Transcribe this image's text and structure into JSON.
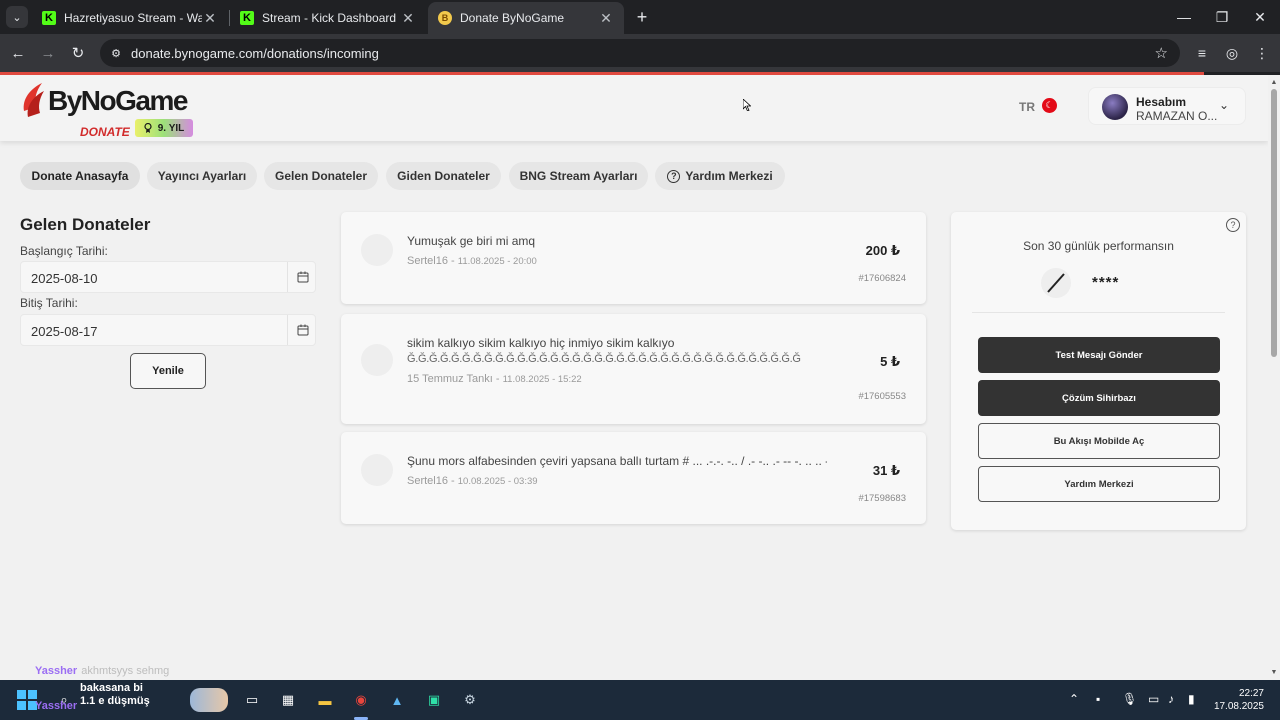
{
  "browser": {
    "tabs": [
      {
        "title": "Hazretiyasuo Stream - Watch Li",
        "favicon": "kick-icon"
      },
      {
        "title": "Stream - Kick Dashboard",
        "favicon": "kick-icon"
      },
      {
        "title": "Donate ByNoGame",
        "favicon": "bynogame-icon",
        "active": true
      }
    ],
    "url": "donate.bynogame.com/donations/incoming"
  },
  "header": {
    "logo_word": "ByNoGame",
    "logo_sub": "DONATE",
    "badge": "9. YIL",
    "lang": "TR",
    "account_title": "Hesabım",
    "account_name": "RAMAZAN O..."
  },
  "nav": [
    "Donate Anasayfa",
    "Yayıncı Ayarları",
    "Gelen Donateler",
    "Giden Donateler",
    "BNG Stream Ayarları",
    "Yardım Merkezi"
  ],
  "filters": {
    "title": "Gelen Donateler",
    "start_label": "Başlangıç Tarihi:",
    "start_value": "2025-08-10",
    "end_label": "Bitiş Tarihi:",
    "end_value": "2025-08-17",
    "refresh": "Yenile"
  },
  "donations": [
    {
      "message": "Yumuşak ge biri mi amq",
      "message2": "",
      "sender": "Sertel16",
      "date": "11.08.2025 - 20:00",
      "amount": "200 ₺",
      "id": "#17606824"
    },
    {
      "message": "sikim kalkıyo sikim kalkıyo hiç inmiyo sikim kalkıyo",
      "message2": "Ğ.Ğ.Ğ.Ğ.Ğ.Ğ.Ğ.Ğ.Ğ.Ğ.Ğ.Ğ.Ğ.Ğ.Ğ.Ğ.Ğ.Ğ.Ğ.Ğ.Ğ.Ğ.Ğ.Ğ.Ğ.Ğ.Ğ.Ğ.Ğ.Ğ.Ğ.Ğ.Ğ.Ğ.Ğ.Ğ",
      "sender": "15 Temmuz Tankı",
      "date": "11.08.2025 - 15:22",
      "amount": "5 ₺",
      "id": "#17605553"
    },
    {
      "message": "Şunu mors alfabesinden çeviri yapsana ballı turtam # ... .-.-. -.. / .- -.. .- -- -. .. .. -.",
      "message2": "",
      "sender": "Sertel16",
      "date": "10.08.2025 - 03:39",
      "amount": "31 ₺",
      "id": "#17598683"
    }
  ],
  "performance": {
    "title": "Son 30 günlük performansın",
    "value": "****",
    "buttons": [
      "Test Mesajı Gönder",
      "Çözüm Sihirbazı",
      "Bu Akışı Mobilde Aç",
      "Yardım Merkezi"
    ]
  },
  "overlay_chat": {
    "user": "Yassher",
    "message": "akhmtsyys sehmg"
  },
  "taskbar": {
    "search_text_line1": "bakasana bi",
    "search_text_line2": "1.1 e düşmüş",
    "overlay_user": "Yassher",
    "time": "22:27",
    "date": "17.08.2025"
  },
  "colors": {
    "accent": "#d12b2b",
    "dark_button": "#333333",
    "page_bg": "#f1f1f1"
  }
}
